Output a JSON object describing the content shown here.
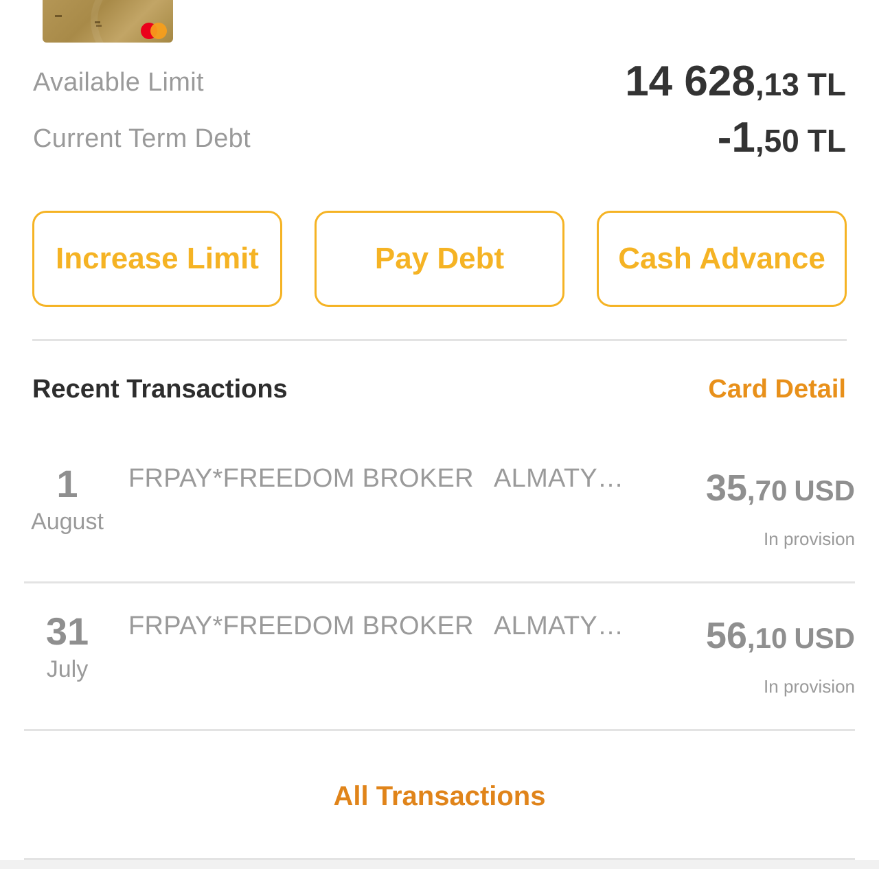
{
  "card": {
    "brand_icon": "mastercard-logo",
    "colors": {
      "card_gold": "#b89a5a",
      "mc_red": "#eb001b",
      "mc_orange": "#f79e1b"
    }
  },
  "summary": {
    "available_limit": {
      "label": "Available Limit",
      "amount_int": "14 628",
      "amount_dec": ",13",
      "currency": "TL"
    },
    "current_term_debt": {
      "label": "Current Term Debt",
      "amount_int": "-1",
      "amount_dec": ",50",
      "currency": "TL"
    }
  },
  "actions": [
    {
      "label": "Increase Limit"
    },
    {
      "label": "Pay Debt"
    },
    {
      "label": "Cash Advance"
    }
  ],
  "recent": {
    "title": "Recent Transactions",
    "card_detail_label": "Card Detail",
    "all_transactions_label": "All Transactions",
    "transactions": [
      {
        "day": "1",
        "month": "August",
        "merchant": "FRPAY*FREEDOM BROKER",
        "city": "ALMATY…",
        "amount_int": "35",
        "amount_dec": ",70",
        "currency": "USD",
        "status": "In provision"
      },
      {
        "day": "31",
        "month": "July",
        "merchant": "FRPAY*FREEDOM BROKER",
        "city": "ALMATY…",
        "amount_int": "56",
        "amount_dec": ",10",
        "currency": "USD",
        "status": "In provision"
      }
    ]
  },
  "colors": {
    "accent_yellow": "#f5b324",
    "accent_orange": "#e8901a",
    "text_dark": "#333333",
    "text_muted": "#9a9a9a",
    "divider": "#e3e3e3"
  }
}
